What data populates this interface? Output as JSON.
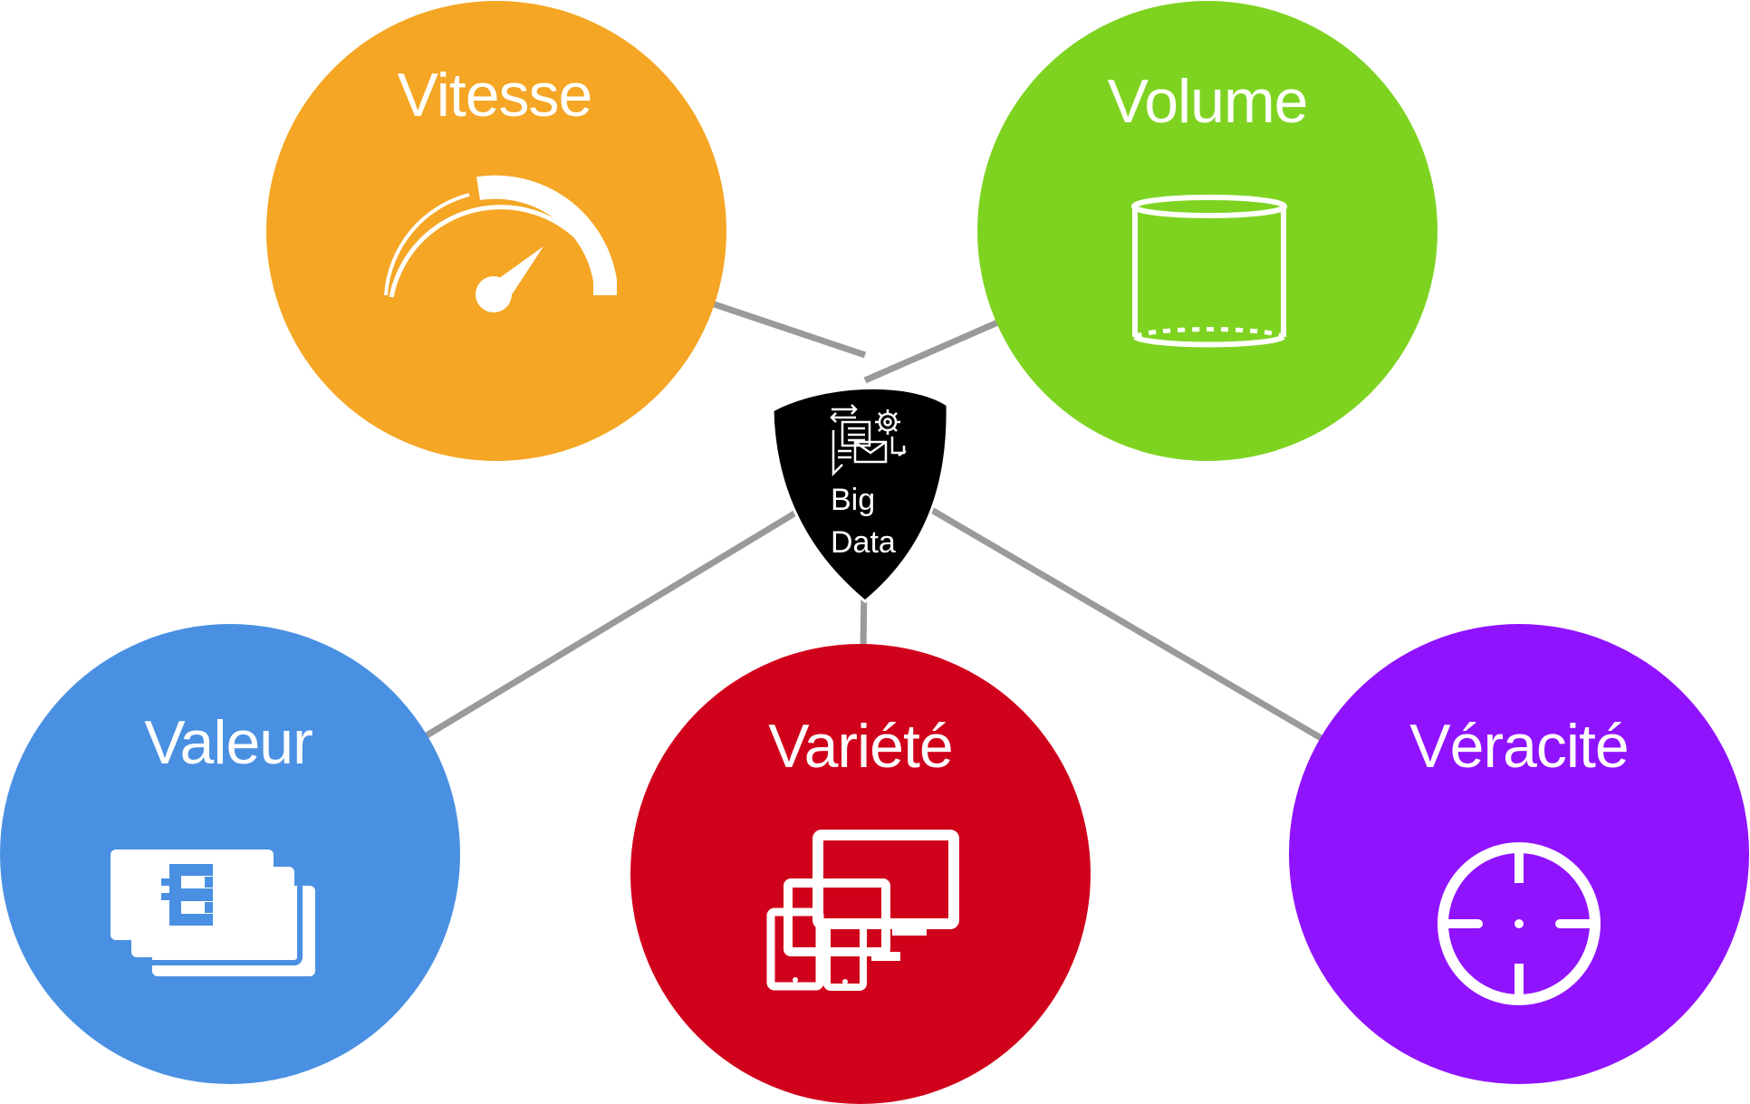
{
  "diagram": {
    "hub": {
      "label_line1": "Big",
      "label_line2": "Data",
      "icon": "big-data-process-icon",
      "color": "#000000"
    },
    "nodes": {
      "vitesse": {
        "label": "Vitesse",
        "icon": "speedometer-icon",
        "color": "#F4A624"
      },
      "volume": {
        "label": "Volume",
        "icon": "cylinder-icon",
        "color": "#7ED321"
      },
      "valeur": {
        "label": "Valeur",
        "icon": "euro-banknotes-icon",
        "color": "#4A90E2"
      },
      "variete": {
        "label": "Variété",
        "icon": "devices-icon",
        "color": "#D0021B"
      },
      "veracite": {
        "label": "Véracité",
        "icon": "crosshair-target-icon",
        "color": "#9013FE"
      }
    },
    "connector_color": "#9A9A9A"
  }
}
